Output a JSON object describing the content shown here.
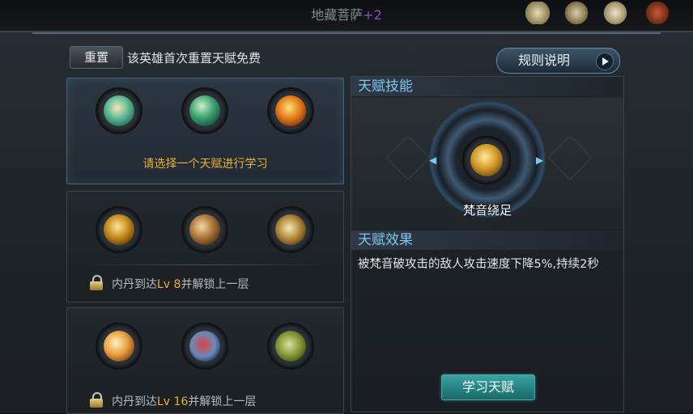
{
  "header": {
    "hero_name": "地藏菩萨",
    "hero_level_suffix": "+2"
  },
  "top_icons": [
    "scroll-icon",
    "medal-icon",
    "paper-icon",
    "book-icon"
  ],
  "toolbar": {
    "reset_label": "重置",
    "reset_note": "该英雄首次重置天赋免费",
    "rules_label": "规则说明"
  },
  "tiers": [
    {
      "talents": [
        "sanskrit-tremor-icon",
        "green-slash-icon",
        "flame-warrior-icon"
      ],
      "prompt": "请选择一个天赋进行学习"
    },
    {
      "talents": [
        "golden-palm-icon",
        "blade-strike-icon",
        "golden-shield-icon"
      ],
      "unlock_prefix": "内丹到达",
      "unlock_lv": "Lv 8",
      "unlock_suffix": "并解锁上一层"
    },
    {
      "talents": [
        "light-burst-icon",
        "crimson-spirit-icon",
        "earth-gauntlet-icon"
      ],
      "unlock_prefix": "内丹到达",
      "unlock_lv": "Lv 16",
      "unlock_suffix": "并解锁上一层"
    }
  ],
  "detail": {
    "skill_section_title": "天赋技能",
    "skill_name": "梵音绕足",
    "effect_section_title": "天赋效果",
    "effect_text": "被梵音破攻击的敌人攻击速度下降5%,持续2秒",
    "learn_label": "学习天赋"
  },
  "colors": {
    "accent_blue": "#7fc6f0",
    "accent_gold": "#e8b23a",
    "learn_teal": "#2a8a8a"
  }
}
